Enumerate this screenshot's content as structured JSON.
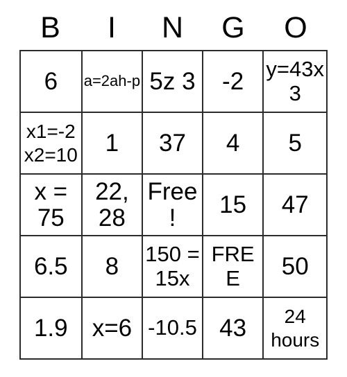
{
  "card": {
    "title": "BINGO card",
    "headers": [
      "B",
      "I",
      "N",
      "G",
      "O"
    ],
    "border_color": "#2b2b2b",
    "background_color": "#ffffff",
    "text_color": "#000000",
    "rows": [
      [
        {
          "text": "6",
          "size": "base"
        },
        {
          "text": "a=2ah-p",
          "size": "sm"
        },
        {
          "text": "5z 3",
          "size": "base"
        },
        {
          "text": "-2",
          "size": "base"
        },
        {
          "text": "y=43x 3",
          "size": "lg"
        }
      ],
      [
        {
          "text": "x1=-2 x2=10",
          "size": "md"
        },
        {
          "text": "1",
          "size": "base"
        },
        {
          "text": "37",
          "size": "base"
        },
        {
          "text": "4",
          "size": "base"
        },
        {
          "text": "5",
          "size": "base"
        }
      ],
      [
        {
          "text": "x = 75",
          "size": "base"
        },
        {
          "text": "22, 28",
          "size": "base"
        },
        {
          "text": "Free!",
          "size": "base"
        },
        {
          "text": "15",
          "size": "base"
        },
        {
          "text": "47",
          "size": "base"
        }
      ],
      [
        {
          "text": "6.5",
          "size": "base"
        },
        {
          "text": "8",
          "size": "base"
        },
        {
          "text": "150 = 15x",
          "size": "lg"
        },
        {
          "text": "FREE",
          "size": "lg"
        },
        {
          "text": "50",
          "size": "base"
        }
      ],
      [
        {
          "text": "1.9",
          "size": "base"
        },
        {
          "text": "x=6",
          "size": "base"
        },
        {
          "text": "-10.5",
          "size": "lg"
        },
        {
          "text": "43",
          "size": "base"
        },
        {
          "text": "24 hours",
          "size": "md"
        }
      ]
    ]
  }
}
